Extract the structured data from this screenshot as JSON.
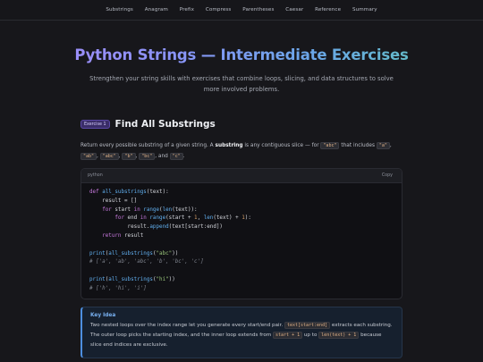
{
  "nav": {
    "items": [
      "Substrings",
      "Anagram",
      "Prefix",
      "Compress",
      "Parentheses",
      "Caesar",
      "Reference",
      "Summary"
    ]
  },
  "hero": {
    "title": "Python Strings — Intermediate Exercises",
    "subtitle": "Strengthen your string skills with exercises that combine loops, slicing, and data structures to solve more involved problems."
  },
  "exercise": {
    "badge": "Exercise 1",
    "title": "Find All Substrings",
    "desc_1": "Return every possible substring of a given string. A",
    "desc_bold": "substring",
    "desc_2": "is any contiguous slice — for",
    "desc_3": "that includes",
    "desc_4": ", and",
    "desc_5": ".",
    "codes": [
      "\"abc\"",
      "\"a\"",
      "\"ab\"",
      "\"abc\"",
      "\"b\"",
      "\"bc\"",
      "\"c\""
    ]
  },
  "code": {
    "language": "python",
    "copy_label": "Copy"
  },
  "callout": {
    "title": "Key Idea",
    "text_1": "Two nested loops over the index range let you generate every start/end pair.",
    "code_1": "text[start:end]",
    "text_2": "extracts each substring. The outer loop picks the starting index, and the inner loop extends from",
    "code_2": "start + 1",
    "text_3": "up to",
    "code_3": "len(text) + 1",
    "text_4": "because slice end indices are exclusive."
  },
  "colors": {
    "background": "#17171b",
    "accent_purple": "#a78bfa",
    "accent_teal": "#5ec9b3",
    "callout_blue": "#78b0f0"
  }
}
